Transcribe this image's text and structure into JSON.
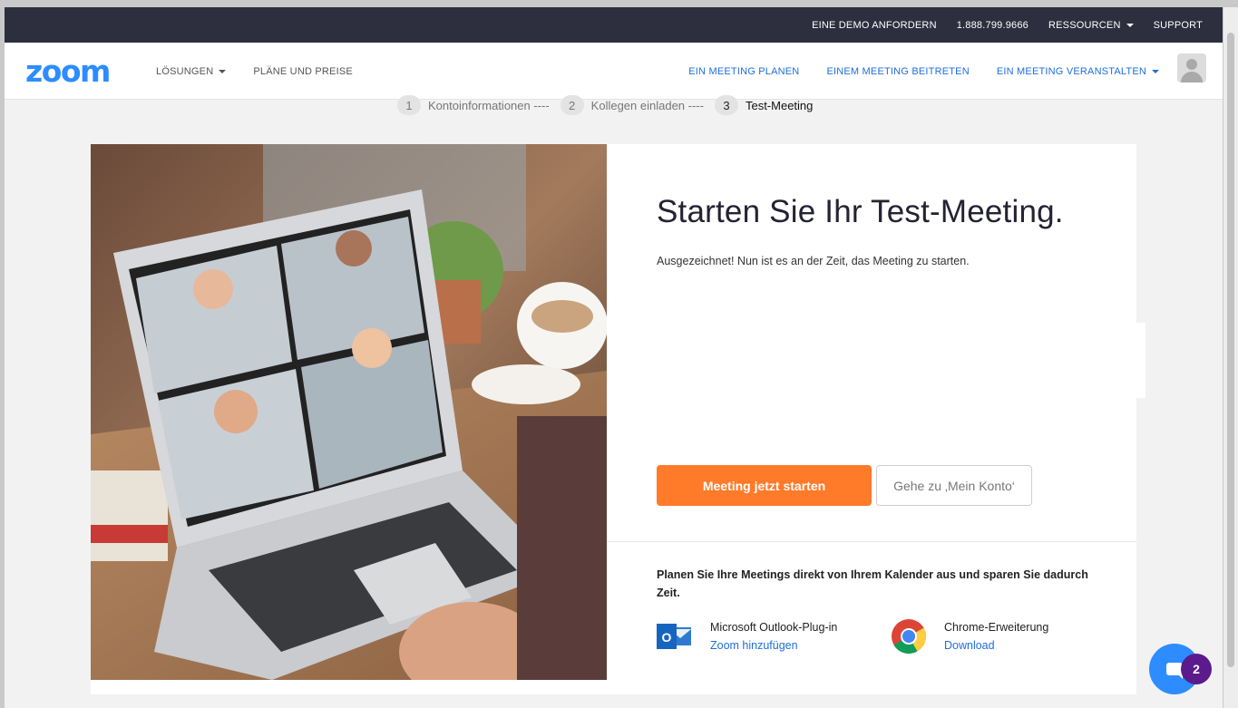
{
  "topbar": {
    "demo": "EINE DEMO ANFORDERN",
    "phone": "1.888.799.9666",
    "resources": "RESSOURCEN",
    "support": "SUPPORT"
  },
  "nav": {
    "logo": "zoom",
    "solutions": "LÖSUNGEN",
    "plans": "PLÄNE UND PREISE",
    "schedule": "EIN MEETING PLANEN",
    "join": "EINEM MEETING BEITRETEN",
    "host": "EIN MEETING VERANSTALTEN"
  },
  "steps": [
    {
      "num": "1",
      "label": "Kontoinformationen ----"
    },
    {
      "num": "2",
      "label": "Kollegen einladen ----"
    },
    {
      "num": "3",
      "label": "Test-Meeting"
    }
  ],
  "main": {
    "title": "Starten Sie Ihr Test-Meeting.",
    "subtitle": "Ausgezeichnet! Nun ist es an der Zeit, das Meeting zu starten.",
    "start_button": "Meeting jetzt starten",
    "account_button": "Gehe zu ‚Mein Konto‘",
    "calendar_text": "Planen Sie Ihre Meetings direkt von Ihrem Kalender aus und sparen Sie dadurch Zeit.",
    "outlook_name": "Microsoft Outlook-Plug-in",
    "outlook_link": "Zoom hinzufügen",
    "chrome_name": "Chrome-Erweiterung",
    "chrome_link": "Download"
  },
  "chat": {
    "badge": "2"
  },
  "colors": {
    "brand_blue": "#2d8cff",
    "start_orange": "#ff7a29",
    "topbar_dark": "#2d2f3f",
    "link_blue": "#1e6fd9",
    "badge_purple": "#5b1b8c"
  }
}
